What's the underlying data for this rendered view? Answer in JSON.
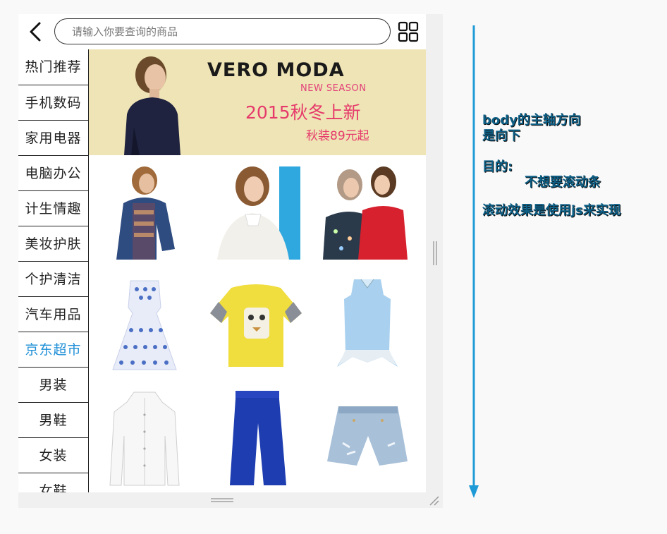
{
  "search": {
    "placeholder": "请输入你要查询的商品"
  },
  "nav": {
    "items": [
      "热门推荐",
      "手机数码",
      "家用电器",
      "电脑办公",
      "计生情趣",
      "美妆护肤",
      "个护清洁",
      "汽车用品",
      "京东超市",
      "男装",
      "男鞋",
      "女装",
      "女鞋"
    ],
    "active_index": 8,
    "active_color": "#1e8fd6"
  },
  "banner": {
    "brand": "VERO MODA",
    "season": "NEW SEASON",
    "headline": "2015秋冬上新",
    "sub": "秋装89元起"
  },
  "annotation": {
    "line1": "body的主轴方向",
    "line2": "是向下",
    "line3": "目的:",
    "line4": "不想要滚动条",
    "line5": "滚动效果是使用js来实现",
    "arrow_color": "#1e9ad6"
  }
}
